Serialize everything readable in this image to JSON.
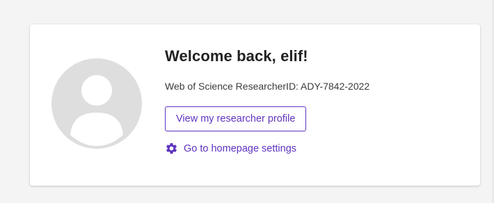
{
  "welcome": {
    "title": "Welcome back, elif!",
    "researcher_id": "Web of Science ResearcherID: ADY-7842-2022",
    "profile_button_label": "View my researcher profile",
    "settings_link_label": "Go to homepage settings"
  },
  "icons": {
    "avatar": "user-placeholder-icon",
    "settings": "gear-icon"
  },
  "colors": {
    "accent": "#5e33bf",
    "avatar_gray": "#dedede",
    "title_text": "#222222"
  }
}
